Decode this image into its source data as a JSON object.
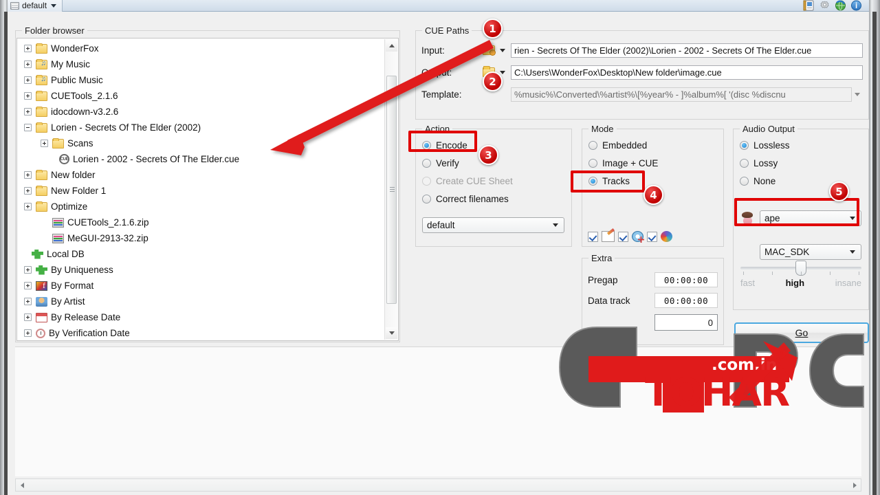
{
  "toolbar": {
    "preset_label": "default",
    "icons": [
      "report-icon",
      "gear-icon",
      "globe-refresh-icon",
      "info-icon"
    ]
  },
  "folder_browser": {
    "title": "Folder browser",
    "items": [
      {
        "label": "WonderFox",
        "icon": "folder-icon",
        "expander": "plus",
        "indent": 0
      },
      {
        "label": "My Music",
        "icon": "music-folder-icon",
        "expander": "plus",
        "indent": 0
      },
      {
        "label": "Public Music",
        "icon": "music-folder-icon",
        "expander": "plus",
        "indent": 0
      },
      {
        "label": "CUETools_2.1.6",
        "icon": "folder-icon",
        "expander": "plus",
        "indent": 0
      },
      {
        "label": "idocdown-v3.2.6",
        "icon": "folder-icon",
        "expander": "plus",
        "indent": 0
      },
      {
        "label": "Lorien - Secrets Of The Elder (2002)",
        "icon": "folder-icon",
        "expander": "minus",
        "indent": 0
      },
      {
        "label": "Scans",
        "icon": "folder-icon",
        "expander": "plus",
        "indent": 1
      },
      {
        "label": "Lorien - 2002 - Secrets Of The Elder.cue",
        "icon": "cue-file-icon",
        "expander": "none",
        "indent": 2
      },
      {
        "label": "New folder",
        "icon": "folder-icon",
        "expander": "plus",
        "indent": 0
      },
      {
        "label": "New Folder 1",
        "icon": "folder-icon",
        "expander": "plus",
        "indent": 0
      },
      {
        "label": "Optimize",
        "icon": "folder-icon",
        "expander": "plus",
        "indent": 0
      },
      {
        "label": "CUETools_2.1.6.zip",
        "icon": "zip-file-icon",
        "expander": "none",
        "indent": 1
      },
      {
        "label": "MeGUI-2913-32.zip",
        "icon": "zip-file-icon",
        "expander": "none",
        "indent": 1
      },
      {
        "label": "Local DB",
        "icon": "puzzle-icon",
        "expander": "none",
        "indent": -1
      },
      {
        "label": "By Uniqueness",
        "icon": "puzzle-icon",
        "expander": "plus",
        "indent": 0
      },
      {
        "label": "By Format",
        "icon": "format-icon",
        "expander": "plus",
        "indent": 0
      },
      {
        "label": "By Artist",
        "icon": "artist-icon",
        "expander": "plus",
        "indent": 0
      },
      {
        "label": "By Release Date",
        "icon": "calendar-icon",
        "expander": "plus",
        "indent": 0
      },
      {
        "label": "By Verification Date",
        "icon": "clock-icon",
        "expander": "plus",
        "indent": 0
      }
    ]
  },
  "cue_paths": {
    "title": "CUE Paths",
    "input_label": "Input:",
    "input_value": "rien - Secrets Of The Elder (2002)\\Lorien - 2002 - Secrets Of The Elder.cue",
    "output_label": "Output:",
    "output_value": "C:\\Users\\WonderFox\\Desktop\\New folder\\image.cue",
    "template_label": "Template:",
    "template_value": "%music%\\Converted\\%artist%\\[%year% - ]%album%[ '(disc %discnu"
  },
  "action": {
    "title": "Action",
    "options": [
      {
        "label": "Encode",
        "selected": true,
        "enabled": true
      },
      {
        "label": "Verify",
        "selected": false,
        "enabled": true
      },
      {
        "label": "Create CUE Sheet",
        "selected": false,
        "enabled": false
      },
      {
        "label": "Correct filenames",
        "selected": false,
        "enabled": true
      }
    ],
    "profile_value": "default"
  },
  "mode": {
    "title": "Mode",
    "options": [
      {
        "label": "Embedded",
        "selected": false
      },
      {
        "label": "Image + CUE",
        "selected": false
      },
      {
        "label": "Tracks",
        "selected": true
      }
    ],
    "toggles": [
      {
        "name": "checkbox-1",
        "type": "checkbox",
        "checked": true
      },
      {
        "name": "edit-cue-icon",
        "type": "icon"
      },
      {
        "name": "checkbox-2",
        "type": "checkbox",
        "checked": true
      },
      {
        "name": "add-disc-icon",
        "type": "icon"
      },
      {
        "name": "checkbox-3",
        "type": "checkbox",
        "checked": true
      },
      {
        "name": "color-sphere-icon",
        "type": "icon"
      }
    ]
  },
  "audio_output": {
    "title": "Audio Output",
    "options": [
      {
        "label": "Lossless",
        "selected": true
      },
      {
        "label": "Lossy",
        "selected": false
      },
      {
        "label": "None",
        "selected": false
      }
    ],
    "format_value": "ape",
    "encoder_value": "MAC_SDK",
    "quality_labels": {
      "low": "fast",
      "mid": "high",
      "high": "insane"
    },
    "quality_selected": "high"
  },
  "extra": {
    "title": "Extra",
    "pregap_label": "Pregap",
    "pregap_value": "00:00:00",
    "datatrack_label": "Data track",
    "datatrack_value": "00:00:00",
    "number_value": "0"
  },
  "go_button": {
    "label": "Go"
  },
  "annotations": {
    "badges": [
      {
        "number": "1",
        "target": "input-browse-button"
      },
      {
        "number": "2",
        "target": "output-browse-button"
      },
      {
        "number": "3",
        "target": "action-encode-radio"
      },
      {
        "number": "4",
        "target": "mode-tracks-radio"
      },
      {
        "number": "5",
        "target": "audio-format-combo"
      }
    ],
    "arrow": {
      "from": "input-browse-button",
      "to": "cue-file-tree-item"
    },
    "highlight_color": "#e00000"
  },
  "watermark": {
    "text_main": "TOHAR",
    "text_g": "G",
    "text_pc": "PC",
    "text_domain": ".com.in",
    "red": "#e01b1b",
    "gray": "#5a5a5a"
  }
}
